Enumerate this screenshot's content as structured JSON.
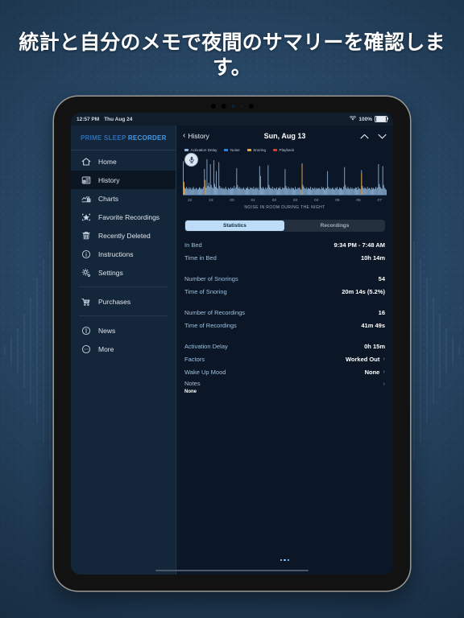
{
  "headline": "統計と自分のメモで夜間のサマリーを確認します。",
  "statusbar": {
    "time": "12:57 PM",
    "date": "Thu Aug 24",
    "wifi_icon": "wifi-icon",
    "battery_percent": "100%"
  },
  "sidebar": {
    "brand_prefix": "PRIME SLEEP ",
    "brand_bright": "RECORDER",
    "items": [
      {
        "label": "Home",
        "icon": "home-icon",
        "selected": false
      },
      {
        "label": "History",
        "icon": "history-icon",
        "selected": true
      },
      {
        "label": "Charts",
        "icon": "charts-icon",
        "selected": false
      },
      {
        "label": "Favorite Recordings",
        "icon": "star-icon",
        "selected": false
      },
      {
        "label": "Recently Deleted",
        "icon": "trash-icon",
        "selected": false
      },
      {
        "label": "Instructions",
        "icon": "info-circle-icon",
        "selected": false
      },
      {
        "label": "Settings",
        "icon": "gear-icon",
        "selected": false
      }
    ],
    "group2": [
      {
        "label": "Purchases",
        "icon": "cart-icon",
        "selected": false
      }
    ],
    "group3": [
      {
        "label": "News",
        "icon": "news-icon",
        "selected": false
      },
      {
        "label": "More",
        "icon": "ellipsis-circle-icon",
        "selected": false
      }
    ]
  },
  "content": {
    "back_label": "History",
    "title": "Sun, Aug 13",
    "prev_icon": "chevron-up-icon",
    "next_icon": "chevron-down-icon",
    "legend": [
      {
        "label": "Activation Delay",
        "color": "#8fb4d8"
      },
      {
        "label": "Noise",
        "color": "#2f7fd6"
      },
      {
        "label": "Snoring",
        "color": "#e8a33d"
      },
      {
        "label": "Playback",
        "color": "#d63b2f"
      }
    ],
    "mic_icon": "microphone-icon",
    "chart_caption": "NOISE IN ROOM DURING THE NIGHT",
    "tabs": [
      {
        "label": "Statistics",
        "active": true
      },
      {
        "label": "Recordings",
        "active": false
      }
    ],
    "stats": [
      {
        "label": "In Bed",
        "value": "9:34 PM - 7:48 AM",
        "chevron": false
      },
      {
        "label": "Time in Bed",
        "value": "10h 14m",
        "chevron": false
      },
      {
        "gap": true
      },
      {
        "label": "Number of Snorings",
        "value": "54",
        "chevron": false
      },
      {
        "label": "Time of Snoring",
        "value": "20m 14s (5.2%)",
        "chevron": false
      },
      {
        "gap": true
      },
      {
        "label": "Number of Recordings",
        "value": "16",
        "chevron": false
      },
      {
        "label": "Time of Recordings",
        "value": "41m 49s",
        "chevron": false
      },
      {
        "gap": true
      },
      {
        "label": "Activation Delay",
        "value": "0h 15m",
        "chevron": false
      },
      {
        "label": "Factors",
        "value": "Worked Out",
        "chevron": true
      },
      {
        "label": "Wake Up Mood",
        "value": "None",
        "chevron": true
      }
    ],
    "notes": {
      "label": "Notes",
      "value": "None",
      "chevron": true
    },
    "more_button_icon": "ellipsis-icon"
  },
  "chart_data": {
    "type": "bar",
    "title": "NOISE IN ROOM DURING THE NIGHT",
    "xlabel": "",
    "ylabel": "",
    "tick_labels": [
      "22",
      "23",
      "00",
      "01",
      "02",
      "03",
      "04",
      "05",
      "06",
      "07"
    ],
    "series": [
      {
        "name": "Noise",
        "color": "#8fb4d8",
        "values": [
          68,
          18,
          14,
          12,
          16,
          13,
          11,
          15,
          12,
          14,
          10,
          13,
          16,
          12,
          11,
          14,
          13,
          10,
          12,
          15,
          14,
          11,
          13,
          12,
          16,
          52,
          20,
          14,
          72,
          18,
          24,
          16,
          62,
          20,
          15,
          13,
          70,
          22,
          16,
          48,
          14,
          12,
          66,
          18,
          13,
          15,
          12,
          14,
          11,
          13,
          16,
          12,
          10,
          14,
          13,
          11,
          15,
          12,
          14,
          13,
          18,
          12,
          15,
          54,
          20,
          13,
          16,
          12,
          14,
          11,
          13,
          15,
          12,
          10,
          14,
          13,
          16,
          12,
          11,
          15,
          13,
          14,
          12,
          16,
          11,
          13,
          15,
          12,
          14,
          10,
          58,
          18,
          14,
          12,
          16,
          13,
          11,
          15,
          12,
          14,
          60,
          20,
          15,
          13,
          12,
          16,
          11,
          14,
          13,
          12,
          15,
          10,
          14,
          13,
          16,
          12,
          11,
          15,
          13,
          14,
          52,
          18,
          14,
          12,
          16,
          13,
          11,
          15,
          12,
          14,
          13,
          10,
          16,
          12,
          11,
          14,
          13,
          15,
          12,
          10,
          64,
          20,
          16,
          13,
          12,
          15,
          11,
          14,
          13,
          12,
          16,
          10,
          14,
          13,
          12,
          15,
          11,
          14,
          12,
          13,
          14,
          12,
          11,
          16,
          13,
          15,
          12,
          10,
          14,
          13,
          48,
          16,
          12,
          14,
          11,
          13,
          15,
          12,
          10,
          14,
          13,
          16,
          12,
          11,
          15,
          13,
          14,
          12,
          10,
          16,
          56,
          20,
          14,
          12,
          16,
          13,
          11,
          15,
          12,
          14,
          11,
          13,
          12,
          15,
          14,
          10,
          16,
          12,
          13,
          11,
          50,
          18,
          14,
          12,
          15,
          13,
          11,
          16,
          12,
          14,
          13,
          10,
          15,
          12,
          14,
          11,
          13,
          16,
          12,
          15,
          62,
          22,
          16,
          13,
          12,
          58,
          20,
          14,
          12,
          10
        ]
      },
      {
        "name": "Snoring",
        "color": "#e8a33d",
        "values": [
          0,
          26,
          0,
          0,
          0,
          0,
          0,
          0,
          0,
          0,
          0,
          0,
          0,
          0,
          0,
          0,
          0,
          0,
          0,
          0,
          0,
          0,
          0,
          0,
          0,
          0,
          30,
          0,
          0,
          0,
          0,
          0,
          0,
          0,
          0,
          0,
          0,
          0,
          0,
          0,
          0,
          0,
          0,
          0,
          0,
          0,
          0,
          0,
          0,
          0,
          0,
          0,
          0,
          0,
          0,
          0,
          0,
          0,
          0,
          0,
          0,
          0,
          0,
          0,
          0,
          0,
          0,
          0,
          0,
          0,
          0,
          0,
          0,
          0,
          0,
          0,
          0,
          0,
          0,
          0,
          0,
          0,
          0,
          0,
          0,
          0,
          0,
          0,
          0,
          0,
          0,
          38,
          0,
          0,
          0,
          0,
          0,
          0,
          0,
          0,
          0,
          0,
          0,
          0,
          0,
          0,
          0,
          0,
          0,
          0,
          0,
          0,
          0,
          0,
          0,
          0,
          0,
          0,
          0,
          0,
          0,
          0,
          0,
          0,
          0,
          0,
          0,
          0,
          0,
          0,
          0,
          0,
          0,
          0,
          0,
          0,
          0,
          0,
          0,
          0,
          62,
          0,
          0,
          0,
          0,
          0,
          0,
          0,
          0,
          0,
          0,
          0,
          0,
          0,
          0,
          0,
          0,
          0,
          0,
          0,
          0,
          0,
          0,
          0,
          0,
          0,
          0,
          0,
          0,
          0,
          0,
          0,
          0,
          0,
          0,
          0,
          0,
          0,
          0,
          0,
          0,
          0,
          0,
          0,
          0,
          0,
          0,
          0,
          0,
          0,
          0,
          0,
          0,
          0,
          0,
          0,
          0,
          0,
          0,
          0,
          0,
          0,
          0,
          0,
          0,
          0,
          0,
          0,
          0,
          0,
          44,
          0,
          0,
          0,
          0,
          0,
          0,
          0,
          0,
          0,
          0,
          0,
          0,
          0,
          0,
          0,
          0,
          0,
          0,
          0,
          0,
          0,
          0,
          0,
          0,
          0,
          0,
          0,
          0,
          0
        ]
      }
    ],
    "ylim": [
      0,
      80
    ],
    "grid": false,
    "legend_position": "top-left"
  }
}
